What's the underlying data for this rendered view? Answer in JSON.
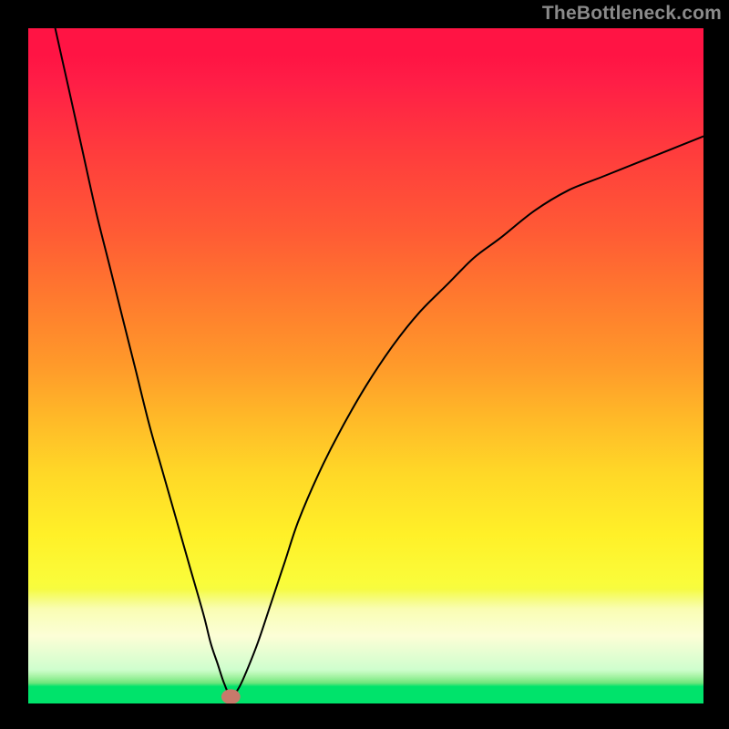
{
  "watermark": {
    "text": "TheBottleneck.com"
  },
  "chart_data": {
    "type": "line",
    "title": "",
    "xlabel": "",
    "ylabel": "",
    "xlim": [
      0,
      100
    ],
    "ylim": [
      0,
      100
    ],
    "grid": false,
    "legend_position": "none",
    "series": [
      {
        "name": "bottleneck-curve",
        "x": [
          4,
          6,
          8,
          10,
          12,
          14,
          16,
          18,
          20,
          22,
          24,
          26,
          27,
          28,
          29,
          30,
          31,
          32,
          34,
          36,
          38,
          40,
          43,
          46,
          50,
          54,
          58,
          62,
          66,
          70,
          75,
          80,
          85,
          90,
          95,
          100
        ],
        "y": [
          100,
          91,
          82,
          73,
          65,
          57,
          49,
          41,
          34,
          27,
          20,
          13,
          9,
          6,
          3,
          1,
          2,
          4,
          9,
          15,
          21,
          27,
          34,
          40,
          47,
          53,
          58,
          62,
          66,
          69,
          73,
          76,
          78,
          80,
          82,
          84
        ]
      }
    ],
    "marker": {
      "x": 30,
      "y": 1,
      "rx": 1.4,
      "ry": 1.1,
      "color": "#c77a6b"
    },
    "gradient_stops": [
      {
        "pos": 0.0,
        "color": "#ff1444"
      },
      {
        "pos": 0.18,
        "color": "#ff3b3d"
      },
      {
        "pos": 0.4,
        "color": "#ff7a2e"
      },
      {
        "pos": 0.58,
        "color": "#ffba28"
      },
      {
        "pos": 0.75,
        "color": "#fff028"
      },
      {
        "pos": 0.88,
        "color": "#e6f85a"
      },
      {
        "pos": 0.97,
        "color": "#36dd7b"
      },
      {
        "pos": 1.0,
        "color": "#00e36b"
      }
    ]
  }
}
